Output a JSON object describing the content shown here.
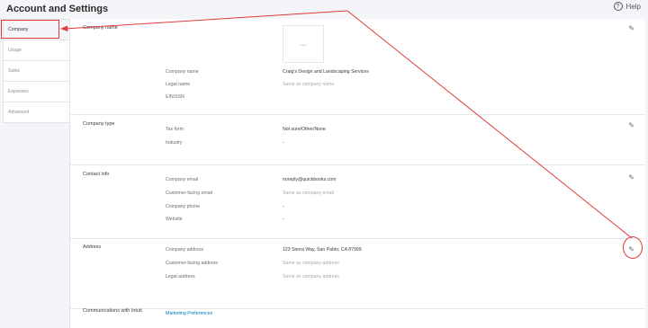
{
  "header": {
    "title": "Account and Settings",
    "help_label": "Help",
    "help_icon": "?"
  },
  "sidebar": {
    "items": [
      {
        "label": "Company",
        "active": true
      },
      {
        "label": "Usage"
      },
      {
        "label": "Sales"
      },
      {
        "label": "Expenses"
      },
      {
        "label": "Advanced"
      }
    ]
  },
  "company_name": {
    "title": "Company name",
    "logo_text": "logo",
    "rows": [
      {
        "label": "Company name",
        "value": "Craig's Design and Landscaping Services"
      },
      {
        "label": "Legal name",
        "value": "Same as company name"
      },
      {
        "label": "EIN/SSN",
        "value": ""
      }
    ]
  },
  "company_type": {
    "title": "Company type",
    "rows": [
      {
        "label": "Tax form",
        "value": "Not sure/Other/None"
      },
      {
        "label": "Industry",
        "value": "-"
      }
    ]
  },
  "contact_info": {
    "title": "Contact info",
    "rows": [
      {
        "label": "Company email",
        "value": "noreply@quickbooks.com"
      },
      {
        "label": "Customer-facing email",
        "value": "Same as company email"
      },
      {
        "label": "Company phone",
        "value": "-"
      },
      {
        "label": "Website",
        "value": "-"
      }
    ]
  },
  "address": {
    "title": "Address",
    "rows": [
      {
        "label": "Company address",
        "value": "123 Sierra Way, San Pablo, CA 87999"
      },
      {
        "label": "Customer-facing address",
        "value": "Same as company address"
      },
      {
        "label": "Legal address",
        "value": "Same as company address"
      }
    ]
  },
  "communications": {
    "title": "Communications with Intuit",
    "link": "Marketing Preferences"
  },
  "colors": {
    "accent_link": "#0077c5",
    "annotation_red": "#e03a3a"
  },
  "icons": {
    "edit": "pencil-icon"
  }
}
